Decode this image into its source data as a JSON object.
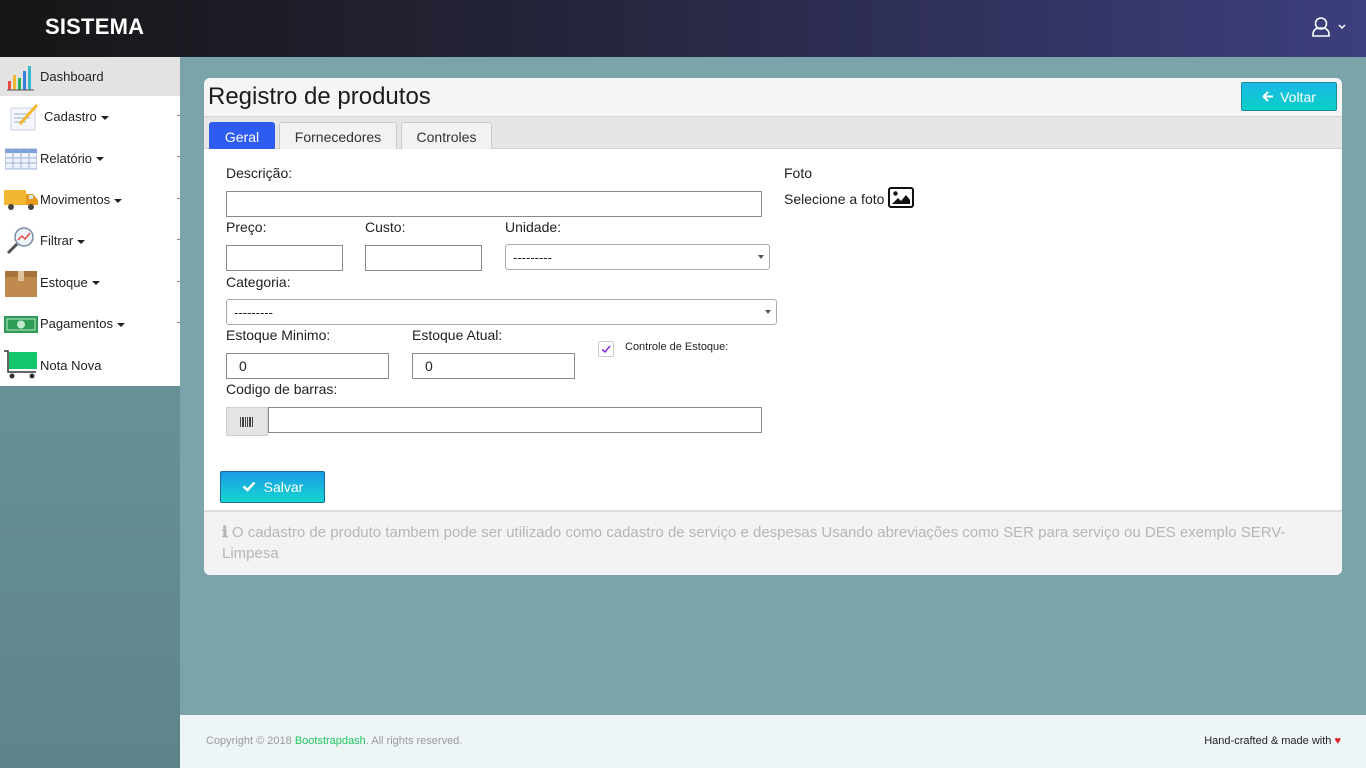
{
  "navbar": {
    "brand": "SISTEMA",
    "user_icon": "user-icon",
    "user_caret": "chevron-down-icon"
  },
  "sidebar": {
    "items": [
      {
        "label": "Dashboard",
        "icon": "chart-icon",
        "has_dropdown": false
      },
      {
        "label": "Cadastro",
        "icon": "notepad-icon",
        "has_dropdown": true
      },
      {
        "label": "Relatório",
        "icon": "spreadsheet-icon",
        "has_dropdown": true
      },
      {
        "label": "Movimentos",
        "icon": "truck-icon",
        "has_dropdown": true
      },
      {
        "label": "Filtrar",
        "icon": "magnifier-chart-icon",
        "has_dropdown": true
      },
      {
        "label": "Estoque",
        "icon": "box-icon",
        "has_dropdown": true
      },
      {
        "label": "Pagamentos",
        "icon": "money-icon",
        "has_dropdown": true
      },
      {
        "label": "Nota Nova",
        "icon": "cart-icon",
        "has_dropdown": false
      }
    ]
  },
  "page": {
    "title": "Registro de produtos",
    "back_button": "Voltar",
    "tabs": [
      "Geral",
      "Fornecedores",
      "Controles"
    ],
    "active_tab": "Geral"
  },
  "form": {
    "descricao_label": "Descrição:",
    "descricao_value": "",
    "preco_label": "Preço:",
    "preco_value": "",
    "custo_label": "Custo:",
    "custo_value": "",
    "unidade_label": "Unidade:",
    "unidade_selected": "---------",
    "categoria_label": "Categoria:",
    "categoria_selected": "---------",
    "estoque_minimo_label": "Estoque Minimo:",
    "estoque_minimo_value": "0",
    "estoque_atual_label": "Estoque Atual:",
    "estoque_atual_value": "0",
    "controle_estoque_label": "Controle de Estoque:",
    "controle_estoque_checked": true,
    "codigo_barras_label": "Codigo de barras:",
    "codigo_barras_value": "",
    "foto_label": "Foto",
    "foto_select_text": "Selecione a foto",
    "save_button": "Salvar"
  },
  "info": {
    "icon": "info-icon",
    "text": "O cadastro de produto tambem pode ser utilizado como cadastro de serviço e despesas Usando abreviações como SER para serviço ou DES exemplo SERV-Limpesa"
  },
  "footer": {
    "copyright_prefix": "Copyright © 2018",
    "brand": "Bootstrapdash",
    "copyright_suffix": ". All rights reserved.",
    "right_text": "Hand-crafted & made with"
  },
  "colors": {
    "accent_blue": "#2f5cf0",
    "button_gradient_start": "#1ab8e6",
    "button_gradient_end": "#14d6cf",
    "page_background": "#7aa4aa",
    "footer_brand": "#1ec760",
    "heart": "#e0242a"
  }
}
